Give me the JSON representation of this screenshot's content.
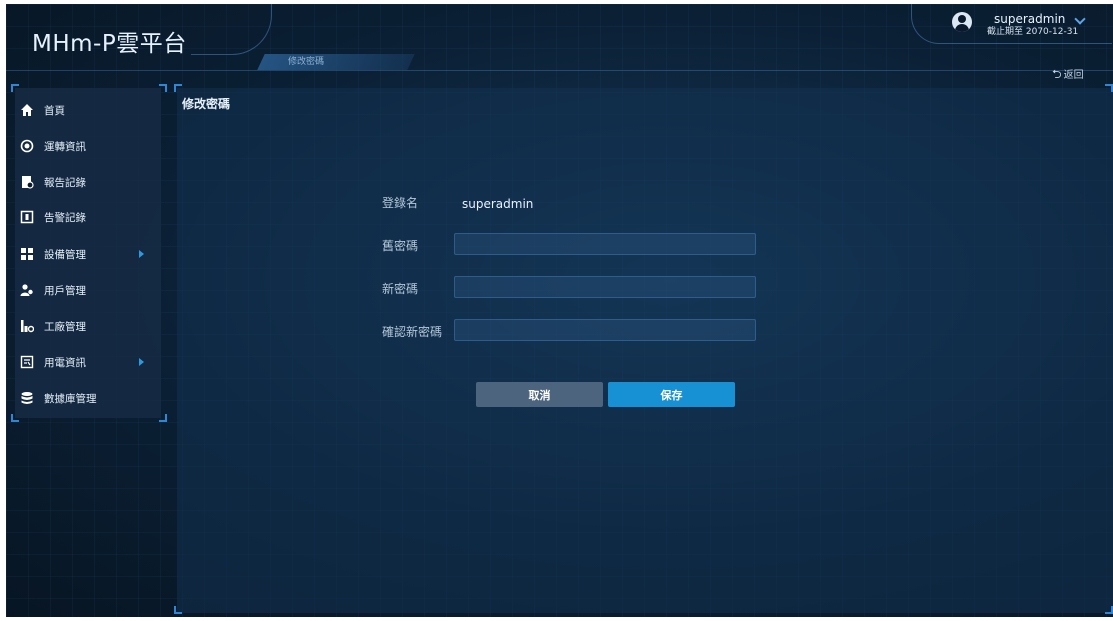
{
  "app": {
    "title": "MHm-P雲平台"
  },
  "breadcrumb": {
    "current": "修改密碼"
  },
  "user": {
    "name": "superadmin",
    "expiry": "截止期至 2070-12-31"
  },
  "header": {
    "back_label": "返回"
  },
  "sidebar": {
    "items": [
      {
        "label": "首頁",
        "icon": "home-icon",
        "has_submenu": false
      },
      {
        "label": "運轉資訊",
        "icon": "operation-icon",
        "has_submenu": false
      },
      {
        "label": "報告記錄",
        "icon": "report-icon",
        "has_submenu": false
      },
      {
        "label": "告警記錄",
        "icon": "alarm-icon",
        "has_submenu": false
      },
      {
        "label": "設備管理",
        "icon": "device-icon",
        "has_submenu": true
      },
      {
        "label": "用戶管理",
        "icon": "users-icon",
        "has_submenu": false
      },
      {
        "label": "工廠管理",
        "icon": "factory-icon",
        "has_submenu": false
      },
      {
        "label": "用電資訊",
        "icon": "power-icon",
        "has_submenu": true
      },
      {
        "label": "數據庫管理",
        "icon": "database-icon",
        "has_submenu": false
      }
    ]
  },
  "main": {
    "title": "修改密碼",
    "form": {
      "login_label": "登錄名",
      "login_value": "superadmin",
      "old_password_label": "舊密碼",
      "old_password_value": "",
      "new_password_label": "新密碼",
      "new_password_value": "",
      "confirm_password_label": "確認新密碼",
      "confirm_password_value": ""
    },
    "buttons": {
      "cancel": "取消",
      "save": "保存"
    }
  },
  "colors": {
    "accent": "#1791d4",
    "cancel": "#4c647d",
    "background": "#0a1a2c"
  }
}
